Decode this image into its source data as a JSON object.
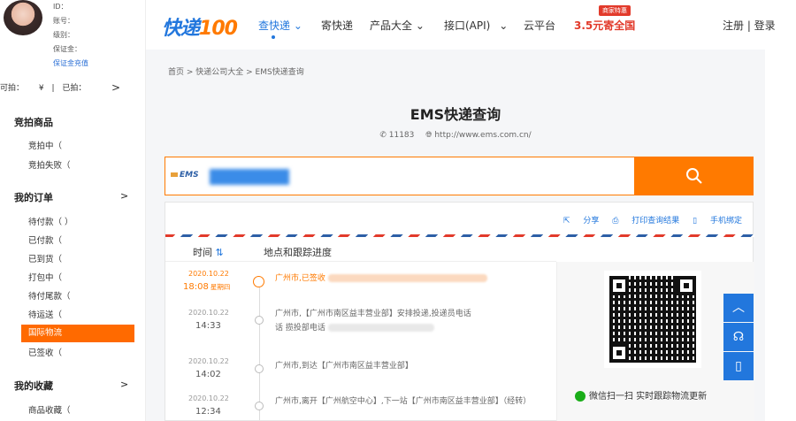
{
  "user": {
    "id_label": "ID：",
    "account_label": "账号：",
    "level_label": "级别：",
    "deposit_label": "保证金：",
    "deposit_link": "保证金充值"
  },
  "balance": {
    "available_label": "可拍：",
    "currency": "¥",
    "separator": "|",
    "taken_label": "已拍：",
    "arrow": ">"
  },
  "sidebar": {
    "groups": [
      {
        "title": "竞拍商品",
        "items": [
          "竞拍中（",
          "竞拍失败（"
        ]
      },
      {
        "title": "我的订单",
        "chevron": ">",
        "items": [
          "待付款（ ）",
          "已付款（",
          "已到货（",
          "打包中（",
          "待付尾款（",
          "待运送（",
          "国际物流",
          "已签收（"
        ]
      },
      {
        "title": "我的收藏",
        "chevron": ">",
        "items": [
          "商品收藏（"
        ]
      }
    ]
  },
  "header": {
    "logo_text": "快递",
    "logo_num": "100",
    "nav": [
      "查快递",
      "寄快递",
      "产品大全",
      "接口(API)",
      "云平台"
    ],
    "nav_chevron": "⌄",
    "promo_badge": "商家特惠",
    "promo_text": "3.5元寄全国",
    "login_text": "注册 | 登录"
  },
  "breadcrumb": "首页  >  快递公司大全  >  EMS快递查询",
  "page": {
    "title": "EMS快递查询",
    "phone": "11183",
    "website": "http://www.ems.com.cn/"
  },
  "search": {
    "carrier_logo": "EMS"
  },
  "actions": {
    "share": "分享",
    "print": "打印查询结果",
    "bind": "手机绑定"
  },
  "columns": {
    "time": "时间",
    "sort_icon": "⇅",
    "progress": "地点和跟踪进度"
  },
  "tracking": [
    {
      "date": "2020.10.22",
      "time": "18:08",
      "weekday": "星期四",
      "text": "广州市,已签收"
    },
    {
      "date": "2020.10.22",
      "time": "14:33",
      "weekday": "",
      "text": "广州市,【广州市南区益丰营业部】安排投递,投递员电话",
      "text2": "话 揽投部电话"
    },
    {
      "date": "2020.10.22",
      "time": "14:02",
      "weekday": "",
      "text": "广州市,到达【广州市南区益丰营业部】"
    },
    {
      "date": "2020.10.22",
      "time": "12:34",
      "weekday": "",
      "text": "广州市,离开【广州航空中心】,下一站【广州市南区益丰营业部】（经转）"
    }
  ],
  "qr": {
    "caption": "微信扫一扫 实时跟踪物流更新"
  },
  "side_buttons": [
    "︿",
    "☊",
    "▯"
  ]
}
